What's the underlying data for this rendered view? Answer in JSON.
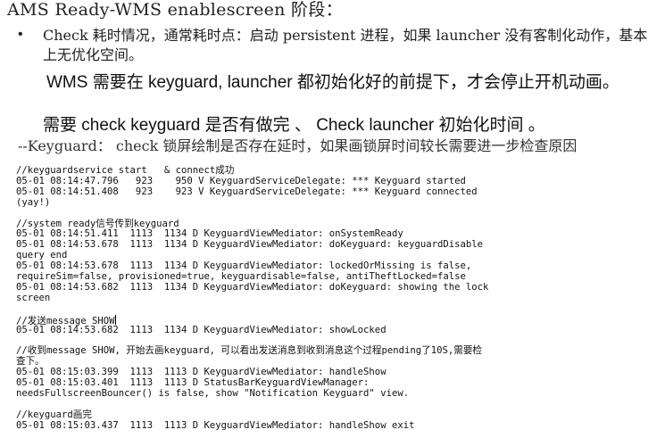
{
  "title": "AMS Ready-WMS enablescreen 阶段：",
  "bullet": {
    "marker": "•",
    "text": "Check 耗时情况，通常耗时点：启动 persistent 进程，如果 launcher 没有客制化动作，基本上无优化空间。"
  },
  "wms_line": "WMS 需要在 keyguard, launcher 都初始化好的前提下，才会停止开机动画。",
  "check_line": "需要 check keyguard 是否有做完 、 Check launcher  初始化时间 。",
  "keyguard_note": "--Keyguard：  check 锁屏绘制是否存在延时，如果画锁屏时间较长需要进一步检查原因",
  "log_blocks": [
    {
      "lines": [
        "//keyguardservice start   & connect成功",
        "05-01 08:14:47.796   923    950 V KeyguardServiceDelegate: *** Keyguard started",
        "05-01 08:14:51.408   923    923 V KeyguardServiceDelegate: *** Keyguard connected",
        "(yay!)"
      ]
    },
    {
      "lines": [
        "//system ready信号传到keyguard",
        "05-01 08:14:51.411  1113  1134 D KeyguardViewMediator: onSystemReady",
        "05-01 08:14:53.678  1113  1134 D KeyguardViewMediator: doKeyguard: keyguardDisable",
        "query end",
        "05-01 08:14:53.678  1113  1134 D KeyguardViewMediator: lockedOrMissing is false,",
        "requireSim=false, provisioned=true, keyguardisable=false, antiTheftLocked=false",
        "05-01 08:14:53.682  1113  1134 D KeyguardViewMediator: doKeyguard: showing the lock",
        "screen"
      ]
    },
    {
      "lines": [
        "//发送message SHOW",
        "05-01 08:14:53.682  1113  1134 D KeyguardViewMediator: showLocked"
      ]
    },
    {
      "lines": [
        "//收到message SHOW, 开始去画keyguard, 可以看出发送消息到收到消息这个过程pending了10S,需要检",
        "查下。",
        "05-01 08:15:03.399  1113  1113 D KeyguardViewMediator: handleShow",
        "05-01 08:15:03.401  1113  1113 D StatusBarKeyguardViewManager:",
        "needsFullscreenBouncer() is false, show \"Notification Keyguard\" view."
      ]
    },
    {
      "lines": [
        "//keyguard画完",
        "05-01 08:15:03.437  1113  1113 D KeyguardViewMediator: handleShow exit"
      ]
    }
  ]
}
